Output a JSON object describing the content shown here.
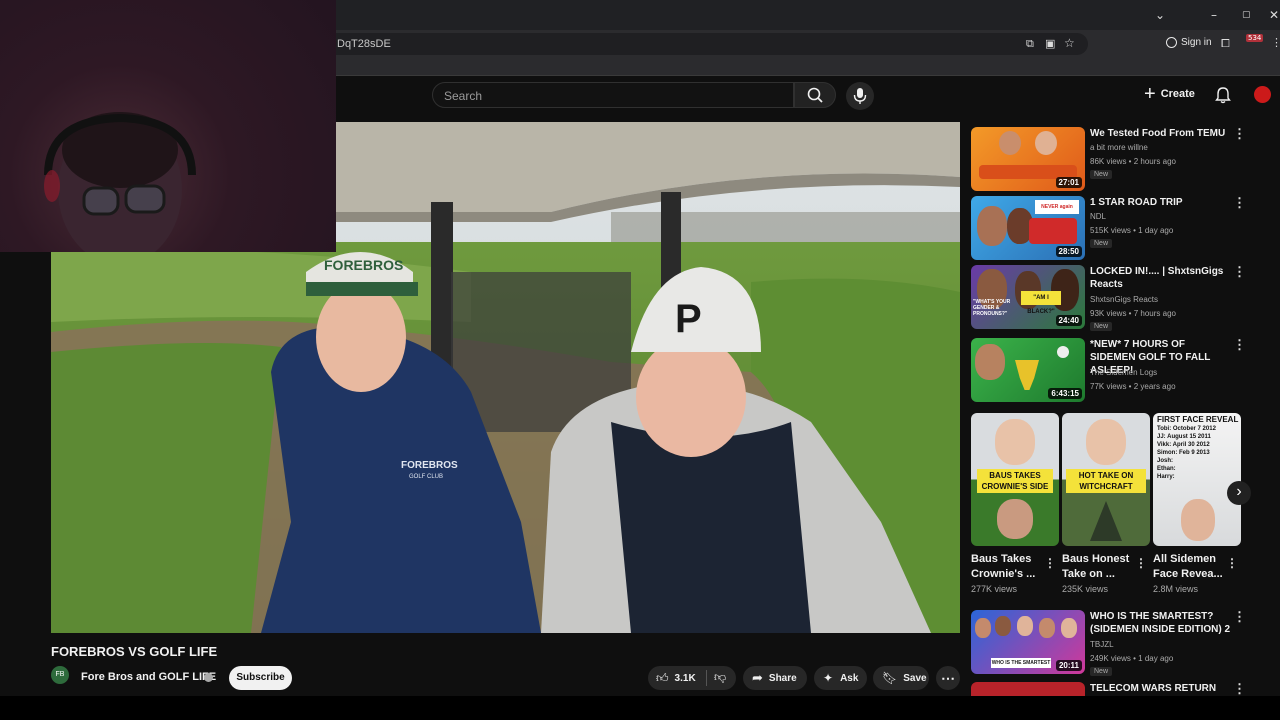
{
  "browser": {
    "url": "DqT28sDE",
    "sign_in": "Sign in",
    "ext_badge": "534"
  },
  "header": {
    "search_placeholder": "Search",
    "create_label": "Create"
  },
  "video": {
    "title": "FOREBROS VS GOLF LIFE",
    "channel": "Fore Bros and GOLF LIFE",
    "subscribe": "Subscribe",
    "likes": "3.1K",
    "share": "Share",
    "ask": "Ask",
    "save": "Save",
    "hoodie_text": "FOREBROS",
    "hoodie_sub": "GOLF CLUB",
    "cap1_text": "FOREBROS",
    "cap2_text": "P"
  },
  "sidebar": {
    "videos": [
      {
        "title": "We Tested Food From TEMU",
        "channel": "a bit more willne",
        "meta": "86K views • 2 hours ago",
        "badge": "New",
        "duration": "27:01"
      },
      {
        "title": "1 STAR ROAD TRIP",
        "channel": "NDL",
        "meta": "515K views • 1 day ago",
        "badge": "New",
        "duration": "28:50",
        "thumb_text": "NEVER again"
      },
      {
        "title": "LOCKED IN!.... | ShxtsnGigs Reacts",
        "channel": "ShxtsnGigs Reacts",
        "meta": "93K views • 7 hours ago",
        "badge": "New",
        "duration": "24:40",
        "thumb_text1": "\"WHAT'S YOUR GENDER & PRONOUNS?\"",
        "thumb_text2": "\"AM I BLACK?\""
      },
      {
        "title": "*NEW* 7 HOURS OF SIDEMEN GOLF TO FALL ASLEEP!",
        "channel": "The Sidemen Logs",
        "meta": "77K views • 2 years ago",
        "duration": "6:43:15"
      },
      {
        "title": "WHO IS THE SMARTEST? (SIDEMEN INSIDE EDITION) 2",
        "channel": "TBJZL",
        "meta": "249K views • 1 day ago",
        "badge": "New",
        "duration": "20:11",
        "thumb_text": "WHO IS THE SMARTEST"
      },
      {
        "title": "TELECOM WARS RETURN FOR"
      }
    ],
    "shorts": [
      {
        "title": "Baus Takes Crownie's ...",
        "views": "277K views",
        "thumb_text": "BAUS TAKES CROWNIE'S SIDE"
      },
      {
        "title": "Baus Honest Take on ...",
        "views": "235K views",
        "thumb_text": "HOT TAKE ON WITCHCRAFT"
      },
      {
        "title": "All Sidemen Face Revea...",
        "views": "2.8M views",
        "thumb_text": "FIRST FACE REVEAL",
        "thumb_lines": [
          "Tobi: October 7 2012",
          "JJ: August 15 2011",
          "Vikk: April 30 2012",
          "Simon: Feb 9 2013",
          "Josh:",
          "Ethan:",
          "Harry:"
        ]
      }
    ]
  },
  "colors": {
    "background": "#0f0f0f",
    "accent_red": "#ff0000",
    "subscribe_bg": "#f1f1f1"
  }
}
